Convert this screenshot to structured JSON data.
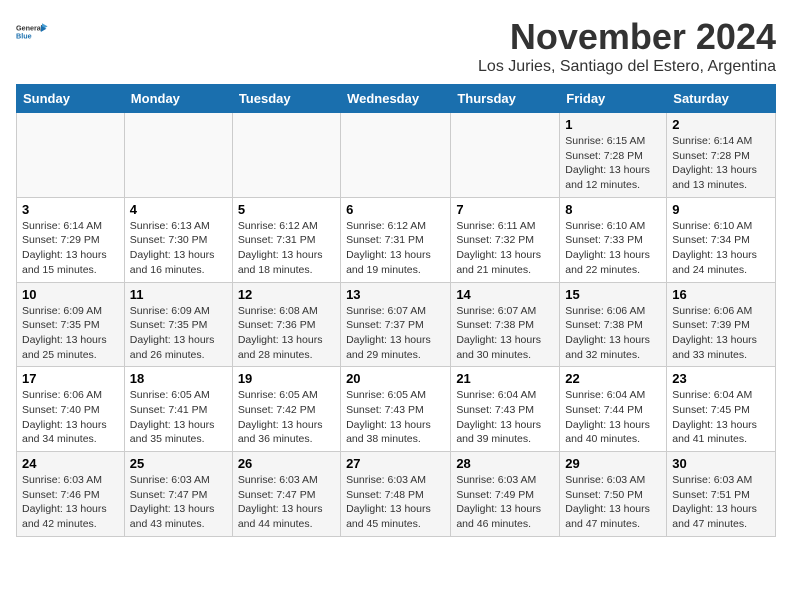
{
  "logo": {
    "line1": "General",
    "line2": "Blue"
  },
  "title": "November 2024",
  "location": "Los Juries, Santiago del Estero, Argentina",
  "weekdays": [
    "Sunday",
    "Monday",
    "Tuesday",
    "Wednesday",
    "Thursday",
    "Friday",
    "Saturday"
  ],
  "weeks": [
    [
      {
        "day": "",
        "info": ""
      },
      {
        "day": "",
        "info": ""
      },
      {
        "day": "",
        "info": ""
      },
      {
        "day": "",
        "info": ""
      },
      {
        "day": "",
        "info": ""
      },
      {
        "day": "1",
        "info": "Sunrise: 6:15 AM\nSunset: 7:28 PM\nDaylight: 13 hours\nand 12 minutes."
      },
      {
        "day": "2",
        "info": "Sunrise: 6:14 AM\nSunset: 7:28 PM\nDaylight: 13 hours\nand 13 minutes."
      }
    ],
    [
      {
        "day": "3",
        "info": "Sunrise: 6:14 AM\nSunset: 7:29 PM\nDaylight: 13 hours\nand 15 minutes."
      },
      {
        "day": "4",
        "info": "Sunrise: 6:13 AM\nSunset: 7:30 PM\nDaylight: 13 hours\nand 16 minutes."
      },
      {
        "day": "5",
        "info": "Sunrise: 6:12 AM\nSunset: 7:31 PM\nDaylight: 13 hours\nand 18 minutes."
      },
      {
        "day": "6",
        "info": "Sunrise: 6:12 AM\nSunset: 7:31 PM\nDaylight: 13 hours\nand 19 minutes."
      },
      {
        "day": "7",
        "info": "Sunrise: 6:11 AM\nSunset: 7:32 PM\nDaylight: 13 hours\nand 21 minutes."
      },
      {
        "day": "8",
        "info": "Sunrise: 6:10 AM\nSunset: 7:33 PM\nDaylight: 13 hours\nand 22 minutes."
      },
      {
        "day": "9",
        "info": "Sunrise: 6:10 AM\nSunset: 7:34 PM\nDaylight: 13 hours\nand 24 minutes."
      }
    ],
    [
      {
        "day": "10",
        "info": "Sunrise: 6:09 AM\nSunset: 7:35 PM\nDaylight: 13 hours\nand 25 minutes."
      },
      {
        "day": "11",
        "info": "Sunrise: 6:09 AM\nSunset: 7:35 PM\nDaylight: 13 hours\nand 26 minutes."
      },
      {
        "day": "12",
        "info": "Sunrise: 6:08 AM\nSunset: 7:36 PM\nDaylight: 13 hours\nand 28 minutes."
      },
      {
        "day": "13",
        "info": "Sunrise: 6:07 AM\nSunset: 7:37 PM\nDaylight: 13 hours\nand 29 minutes."
      },
      {
        "day": "14",
        "info": "Sunrise: 6:07 AM\nSunset: 7:38 PM\nDaylight: 13 hours\nand 30 minutes."
      },
      {
        "day": "15",
        "info": "Sunrise: 6:06 AM\nSunset: 7:38 PM\nDaylight: 13 hours\nand 32 minutes."
      },
      {
        "day": "16",
        "info": "Sunrise: 6:06 AM\nSunset: 7:39 PM\nDaylight: 13 hours\nand 33 minutes."
      }
    ],
    [
      {
        "day": "17",
        "info": "Sunrise: 6:06 AM\nSunset: 7:40 PM\nDaylight: 13 hours\nand 34 minutes."
      },
      {
        "day": "18",
        "info": "Sunrise: 6:05 AM\nSunset: 7:41 PM\nDaylight: 13 hours\nand 35 minutes."
      },
      {
        "day": "19",
        "info": "Sunrise: 6:05 AM\nSunset: 7:42 PM\nDaylight: 13 hours\nand 36 minutes."
      },
      {
        "day": "20",
        "info": "Sunrise: 6:05 AM\nSunset: 7:43 PM\nDaylight: 13 hours\nand 38 minutes."
      },
      {
        "day": "21",
        "info": "Sunrise: 6:04 AM\nSunset: 7:43 PM\nDaylight: 13 hours\nand 39 minutes."
      },
      {
        "day": "22",
        "info": "Sunrise: 6:04 AM\nSunset: 7:44 PM\nDaylight: 13 hours\nand 40 minutes."
      },
      {
        "day": "23",
        "info": "Sunrise: 6:04 AM\nSunset: 7:45 PM\nDaylight: 13 hours\nand 41 minutes."
      }
    ],
    [
      {
        "day": "24",
        "info": "Sunrise: 6:03 AM\nSunset: 7:46 PM\nDaylight: 13 hours\nand 42 minutes."
      },
      {
        "day": "25",
        "info": "Sunrise: 6:03 AM\nSunset: 7:47 PM\nDaylight: 13 hours\nand 43 minutes."
      },
      {
        "day": "26",
        "info": "Sunrise: 6:03 AM\nSunset: 7:47 PM\nDaylight: 13 hours\nand 44 minutes."
      },
      {
        "day": "27",
        "info": "Sunrise: 6:03 AM\nSunset: 7:48 PM\nDaylight: 13 hours\nand 45 minutes."
      },
      {
        "day": "28",
        "info": "Sunrise: 6:03 AM\nSunset: 7:49 PM\nDaylight: 13 hours\nand 46 minutes."
      },
      {
        "day": "29",
        "info": "Sunrise: 6:03 AM\nSunset: 7:50 PM\nDaylight: 13 hours\nand 47 minutes."
      },
      {
        "day": "30",
        "info": "Sunrise: 6:03 AM\nSunset: 7:51 PM\nDaylight: 13 hours\nand 47 minutes."
      }
    ]
  ]
}
